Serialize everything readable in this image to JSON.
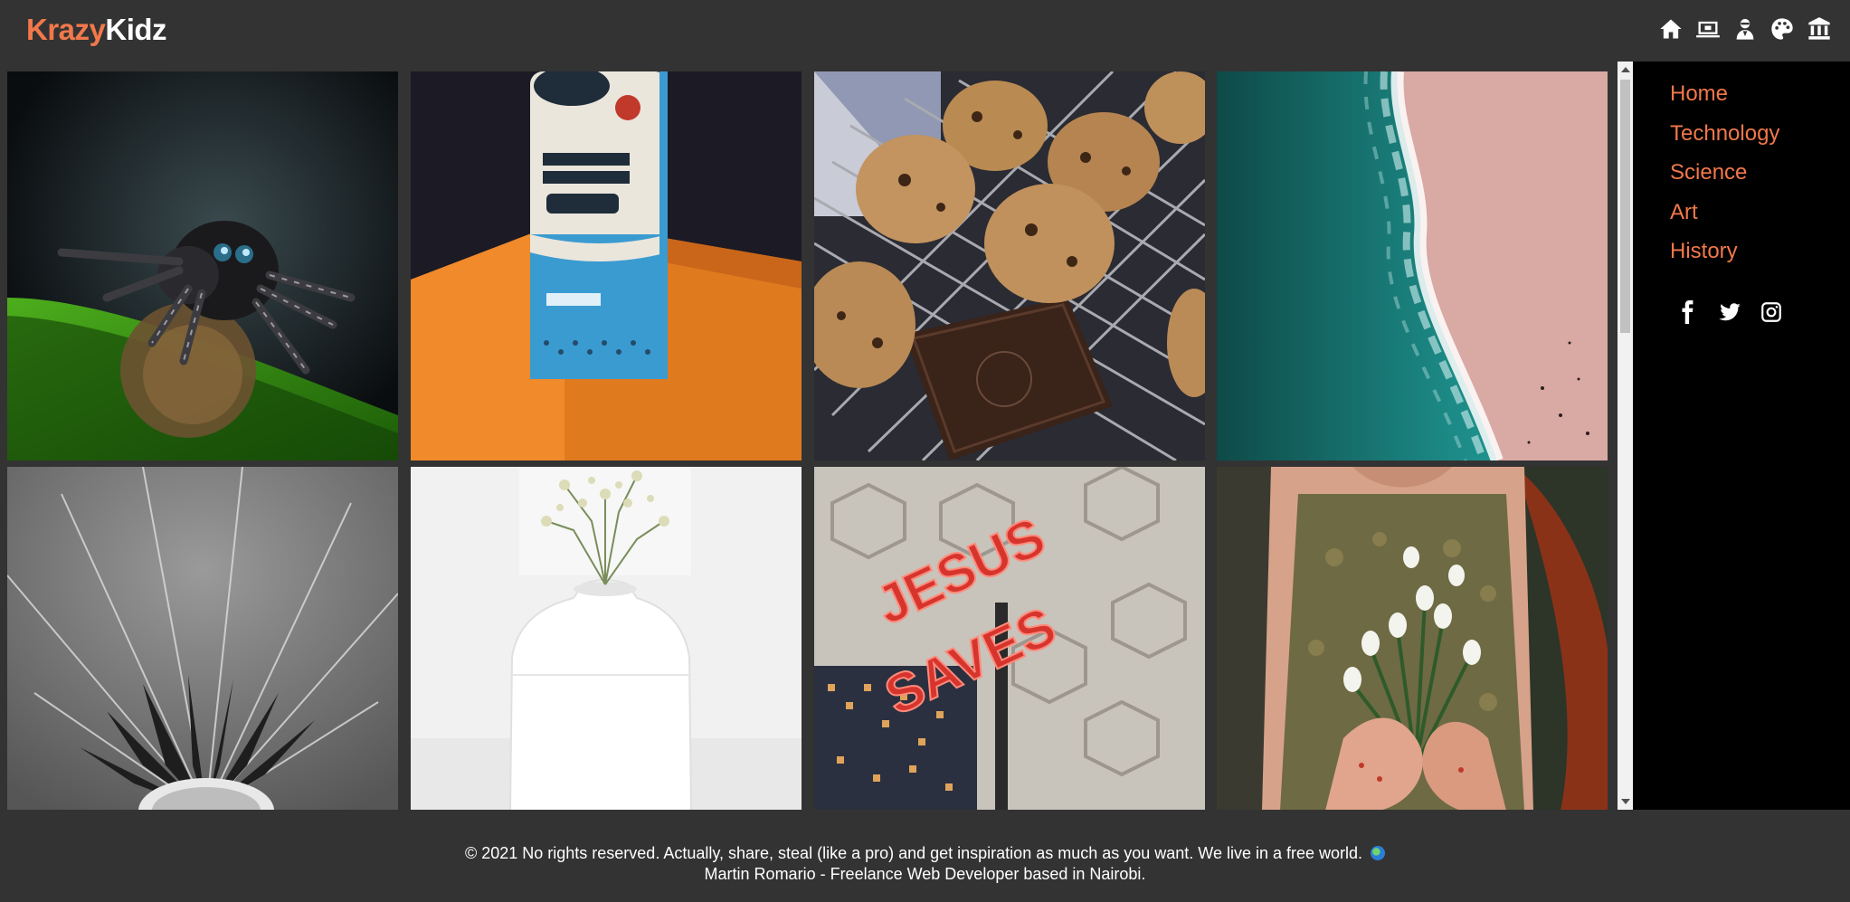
{
  "brand": {
    "part1": "Krazy",
    "part2": "Kidz",
    "accent_color": "#f2784b"
  },
  "header": {
    "icons": [
      "home-icon",
      "laptop-icon",
      "scientist-icon",
      "palette-icon",
      "landmark-icon"
    ]
  },
  "gallery": {
    "images": [
      {
        "name": "jumping-spider-photo"
      },
      {
        "name": "coconut-water-kefir-can-photo"
      },
      {
        "name": "muffins-on-rack-photo"
      },
      {
        "name": "aerial-beach-waves-photo"
      },
      {
        "name": "dandelion-macro-photo"
      },
      {
        "name": "white-vase-flowers-photo"
      },
      {
        "name": "jesus-saves-neon-sign-photo"
      },
      {
        "name": "woman-holding-snowdrops-photo"
      }
    ]
  },
  "sidebar": {
    "nav": [
      "Home",
      "Technology",
      "Science",
      "Art",
      "History"
    ],
    "social": [
      "facebook-icon",
      "twitter-icon",
      "instagram-icon"
    ]
  },
  "footer": {
    "line1": "© 2021 No rights reserved. Actually, share, steal (like a pro) and get inspiration as much as you want. We live in a free world.",
    "line2": "Martin Romario - Freelance Web Developer based in Nairobi."
  }
}
